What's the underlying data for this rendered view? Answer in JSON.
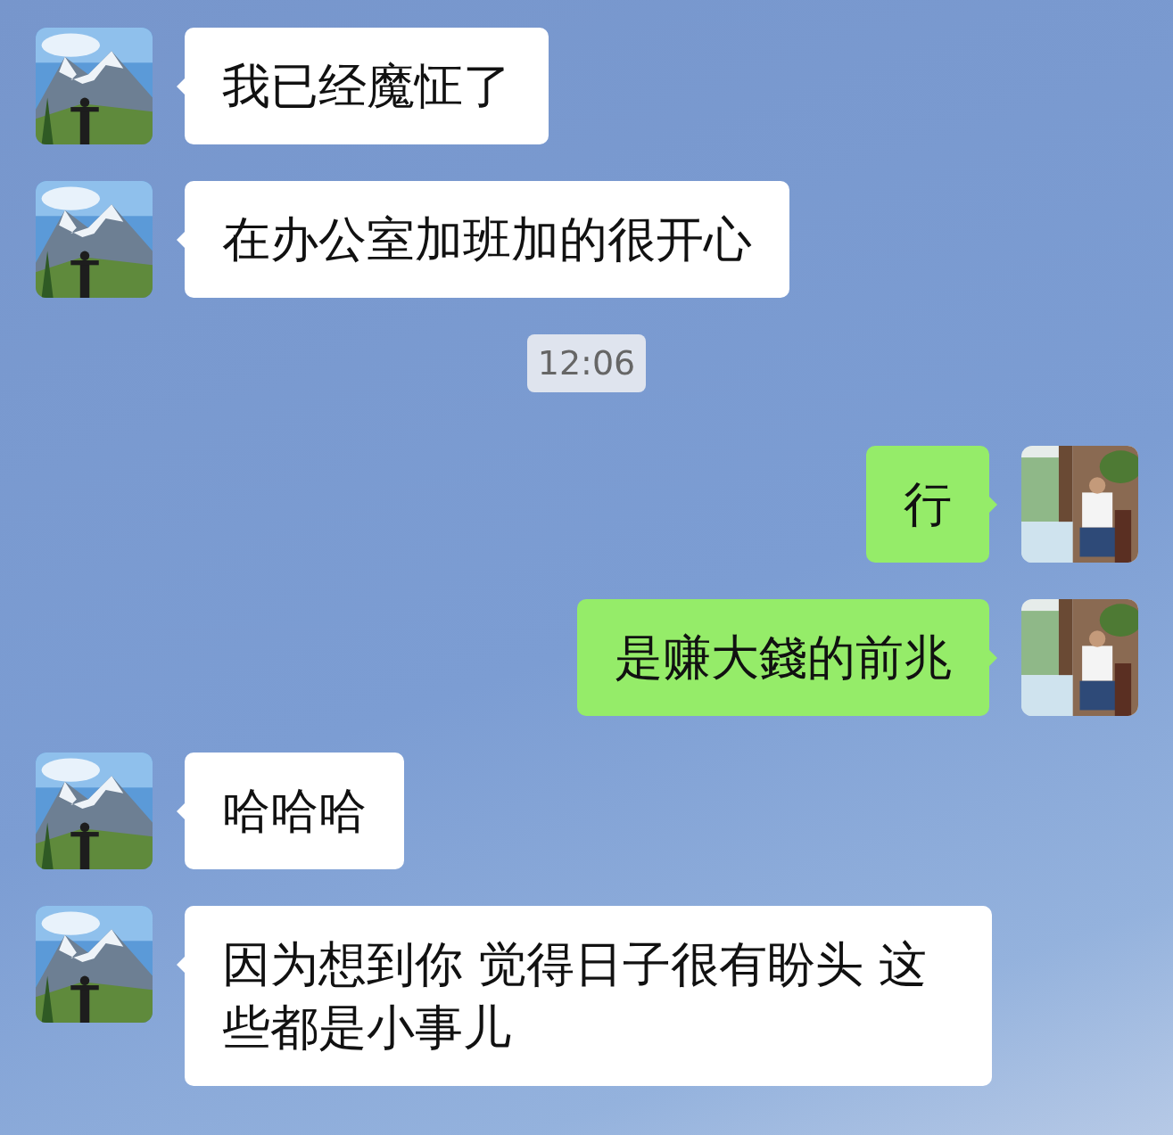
{
  "messages": [
    {
      "kind": "incoming",
      "text": "我已经魔怔了"
    },
    {
      "kind": "incoming",
      "text": "在办公室加班加的很开心"
    },
    {
      "kind": "time",
      "text": "12:06"
    },
    {
      "kind": "outgoing",
      "text": "行"
    },
    {
      "kind": "outgoing",
      "text": "是赚大錢的前兆"
    },
    {
      "kind": "incoming",
      "text": "哈哈哈"
    },
    {
      "kind": "incoming",
      "text": "因为想到你 觉得日子很有盼头 这些都是小事儿"
    }
  ]
}
